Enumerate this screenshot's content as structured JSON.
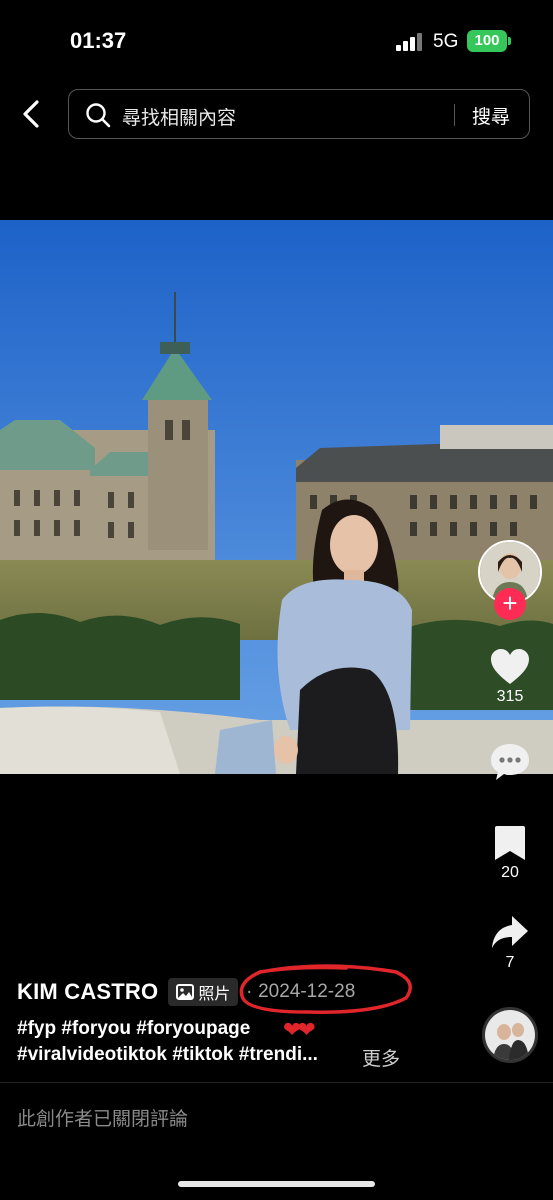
{
  "status_bar": {
    "time": "01:37",
    "network": "5G",
    "battery": "100"
  },
  "search": {
    "placeholder": "尋找相關內容",
    "submit_label": "搜尋"
  },
  "actions": {
    "likes": "315",
    "bookmarks": "20",
    "shares": "7"
  },
  "post": {
    "author": "KIM CASTRO",
    "photo_tag": "照片",
    "separator": "·",
    "date": "2024-12-28",
    "caption_line1": "#fyp #foryou #foryoupage",
    "caption_hearts": "❤❤",
    "caption_line2": "#viralvideotiktok #tiktok #trendi...",
    "more_label": "更多"
  },
  "comments": {
    "disabled_text": "此創作者已關閉評論"
  },
  "colors": {
    "accent": "#fe2c55",
    "battery": "#35c759",
    "annotation": "#e0262b"
  }
}
